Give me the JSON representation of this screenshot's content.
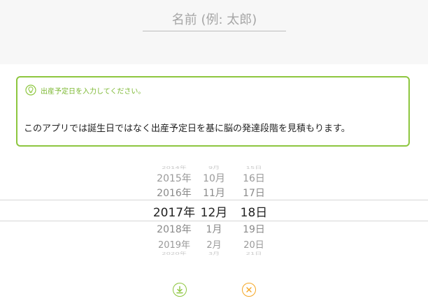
{
  "name_field": {
    "placeholder": "名前 (例: 太郎)",
    "value": ""
  },
  "info": {
    "icon": "lightbulb-icon",
    "title": "出産予定日を入力してください。",
    "description": "このアプリでは誕生日ではなく出産予定日を基に脳の発達段階を見積もります。"
  },
  "picker": {
    "years": [
      "2014年",
      "2015年",
      "2016年",
      "2017年",
      "2018年",
      "2019年",
      "2020年"
    ],
    "months": [
      "9月",
      "10月",
      "11月",
      "12月",
      "1月",
      "2月",
      "3月"
    ],
    "days": [
      "15日",
      "16日",
      "17日",
      "18日",
      "19日",
      "20日",
      "21日"
    ],
    "selected": {
      "year": "2017年",
      "month": "12月",
      "day": "18日"
    }
  },
  "actions": {
    "confirm_icon": "download-arrow-icon",
    "cancel_icon": "close-icon"
  },
  "colors": {
    "accent_green": "#8dc63f",
    "cancel_orange": "#f5a623",
    "text_dark": "#222222"
  }
}
